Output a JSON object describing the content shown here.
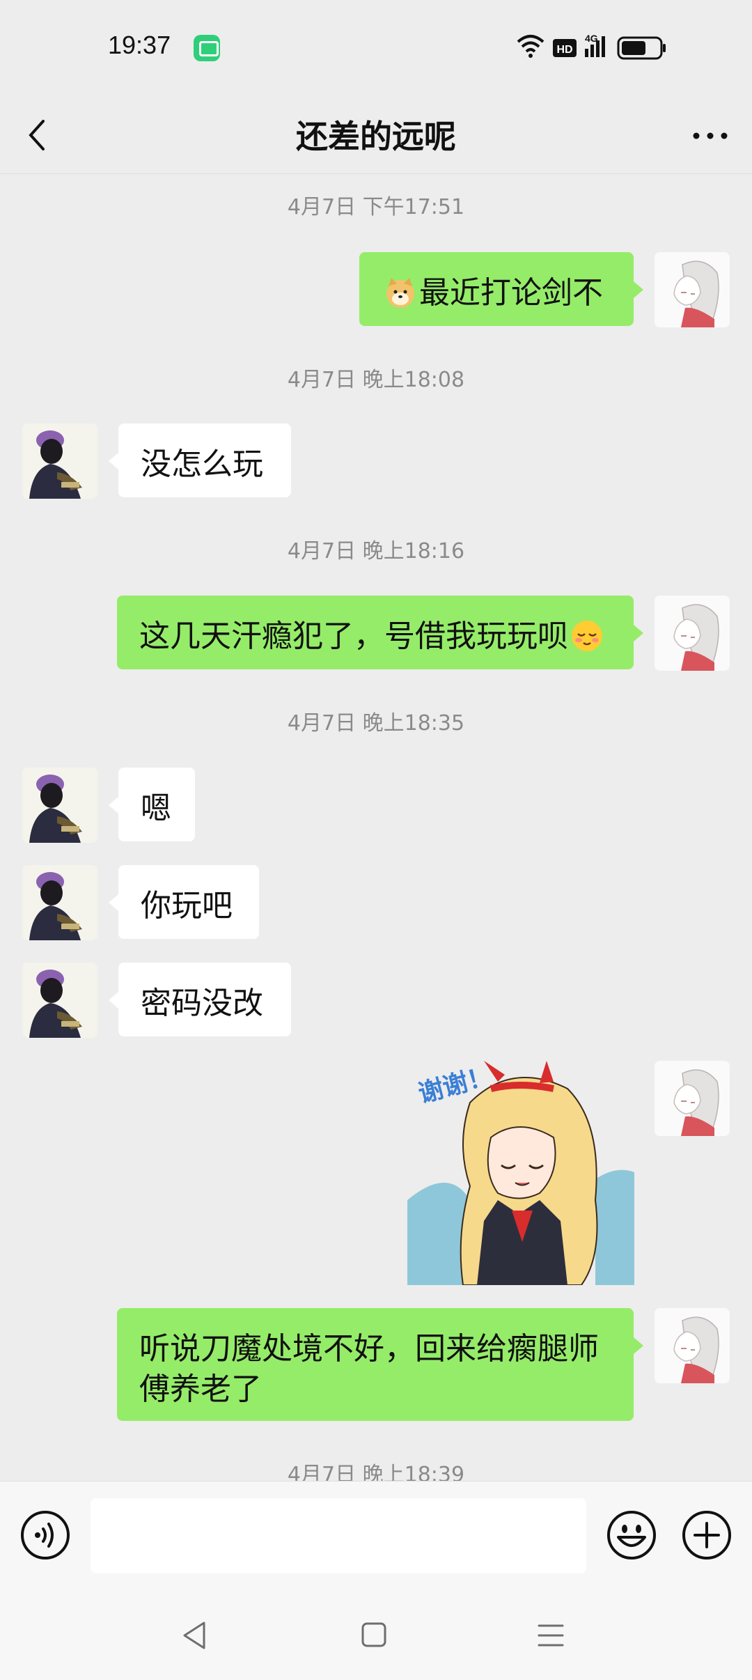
{
  "status": {
    "time": "19:37",
    "hd_label": "HD",
    "network_label": "4G"
  },
  "header": {
    "title": "还差的远呢"
  },
  "messages": {
    "ts1": "4月7日 下午17:51",
    "m1": "最近打论剑不",
    "ts2": "4月7日 晚上18:08",
    "m2": "没怎么玩",
    "ts3": "4月7日 晚上18:16",
    "m3": "这几天汗瘾犯了，号借我玩玩呗",
    "ts4": "4月7日 晚上18:35",
    "m4": "嗯",
    "m5": "你玩吧",
    "m6": "密码没改",
    "sticker_text": "谢谢！",
    "m7_line1": "听说刀魔处境不好，回来给瘸腿师",
    "m7_line2": "傅养老了",
    "ts5": "4月7日 晚上18:39"
  },
  "icons": {
    "back": "chevron-left-icon",
    "more": "more-dots-icon",
    "voice": "voice-icon",
    "emoji": "emoji-icon",
    "plus": "plus-icon",
    "wifi": "wifi-icon",
    "signal": "signal-icon",
    "battery": "battery-icon"
  },
  "colors": {
    "bubble_me": "#95ec69",
    "bubble_them": "#ffffff",
    "background": "#ededed"
  }
}
